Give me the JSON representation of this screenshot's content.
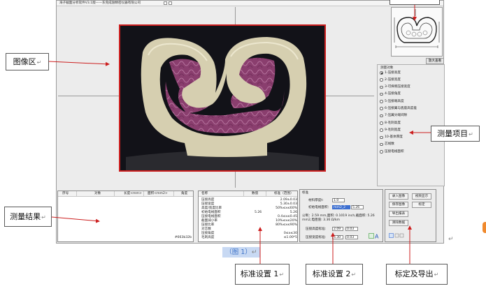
{
  "app": {
    "title": "海子截面分析软件V3.1版——东莞成翅精密仪器有限公司"
  },
  "thumbnail": {
    "zoom_button_label": "放大查看"
  },
  "measure_items": {
    "group_title": "测量对象",
    "items": [
      {
        "label": "1-压接高度",
        "checked": true
      },
      {
        "label": "2-压接宽度",
        "checked": false
      },
      {
        "label": "3-可择侧压接宽度",
        "checked": false
      },
      {
        "label": "4-压接角度",
        "checked": false
      },
      {
        "label": "5-压接端高度",
        "checked": false
      },
      {
        "label": "6-压接翼与底座高度差",
        "checked": false
      },
      {
        "label": "7-压翼尖端间隙",
        "checked": false
      },
      {
        "label": "8-毛刺高度",
        "checked": false
      },
      {
        "label": "9-毛刺宽度",
        "checked": false
      },
      {
        "label": "10-基体厚度",
        "checked": false
      },
      {
        "label": "芯线数",
        "checked": false
      },
      {
        "label": "压接电线面积",
        "checked": false
      }
    ]
  },
  "results": {
    "columns": [
      "序号",
      "对象",
      "长度<mm>",
      "面积<mm2>",
      "角度"
    ],
    "footer": "#663b32b"
  },
  "standard_1": {
    "columns": [
      "名称",
      "数值",
      "标准（范围）"
    ],
    "rows": [
      {
        "name": "压接高度",
        "value": "",
        "std": "2.09±0.03"
      },
      {
        "name": "压接宽度",
        "value": "",
        "std": "5.30±0.03"
      },
      {
        "name": "高度/宽度比率",
        "value": "",
        "std": "50%≤x≤60%"
      },
      {
        "name": "初始电线面积",
        "value": "5.26",
        "std": "5.26"
      },
      {
        "name": "压接电线面积",
        "value": "",
        "std": "0.4≤x≤0.45"
      },
      {
        "name": "截面减小率",
        "value": "",
        "std": "10%≤x≤20%"
      },
      {
        "name": "压接比率",
        "value": "",
        "std": "80%≤x≤90%"
      },
      {
        "name": "对芯数",
        "value": "",
        "std": ""
      },
      {
        "name": "压接角度",
        "value": "",
        "std": "0≤x≤30"
      },
      {
        "name": "毛刺高度",
        "value": "",
        "std": "≤1.00*5"
      }
    ]
  },
  "standard_2": {
    "group_title": "标准",
    "material_thickness_label": "材料厚度t:",
    "material_thickness_value": "1.0",
    "initial_area_label": "初始电线面积：",
    "initial_area_unit": "mm2_2",
    "initial_area_value": "5.26",
    "info_line_1": "公制：2.59 mm,面积: 0.1019 inch,截面积: 5.26",
    "info_line_2": "mm2,电阻值: 3.36 Ω/km",
    "crimp_height_label": "压接高度标准:",
    "crimp_height_value": "2.09",
    "crimp_height_tol": "0.03",
    "crimp_width_label": "压接宽度标准:",
    "crimp_width_value": "5.30",
    "crimp_width_tol": "0.03"
  },
  "export": {
    "buttons": [
      "录入图像",
      "视频显示",
      "保存图像",
      "标定",
      "导出报表",
      "清除数据"
    ]
  },
  "annotations": {
    "image_area": "图像区",
    "measure_items": "测量项目",
    "results": "测量结果",
    "std1": "标准设置 1",
    "std2": "标准设置 2",
    "export": "标定及导出",
    "caption": "（图 1）",
    "mark": "↵",
    "para": "↵"
  }
}
